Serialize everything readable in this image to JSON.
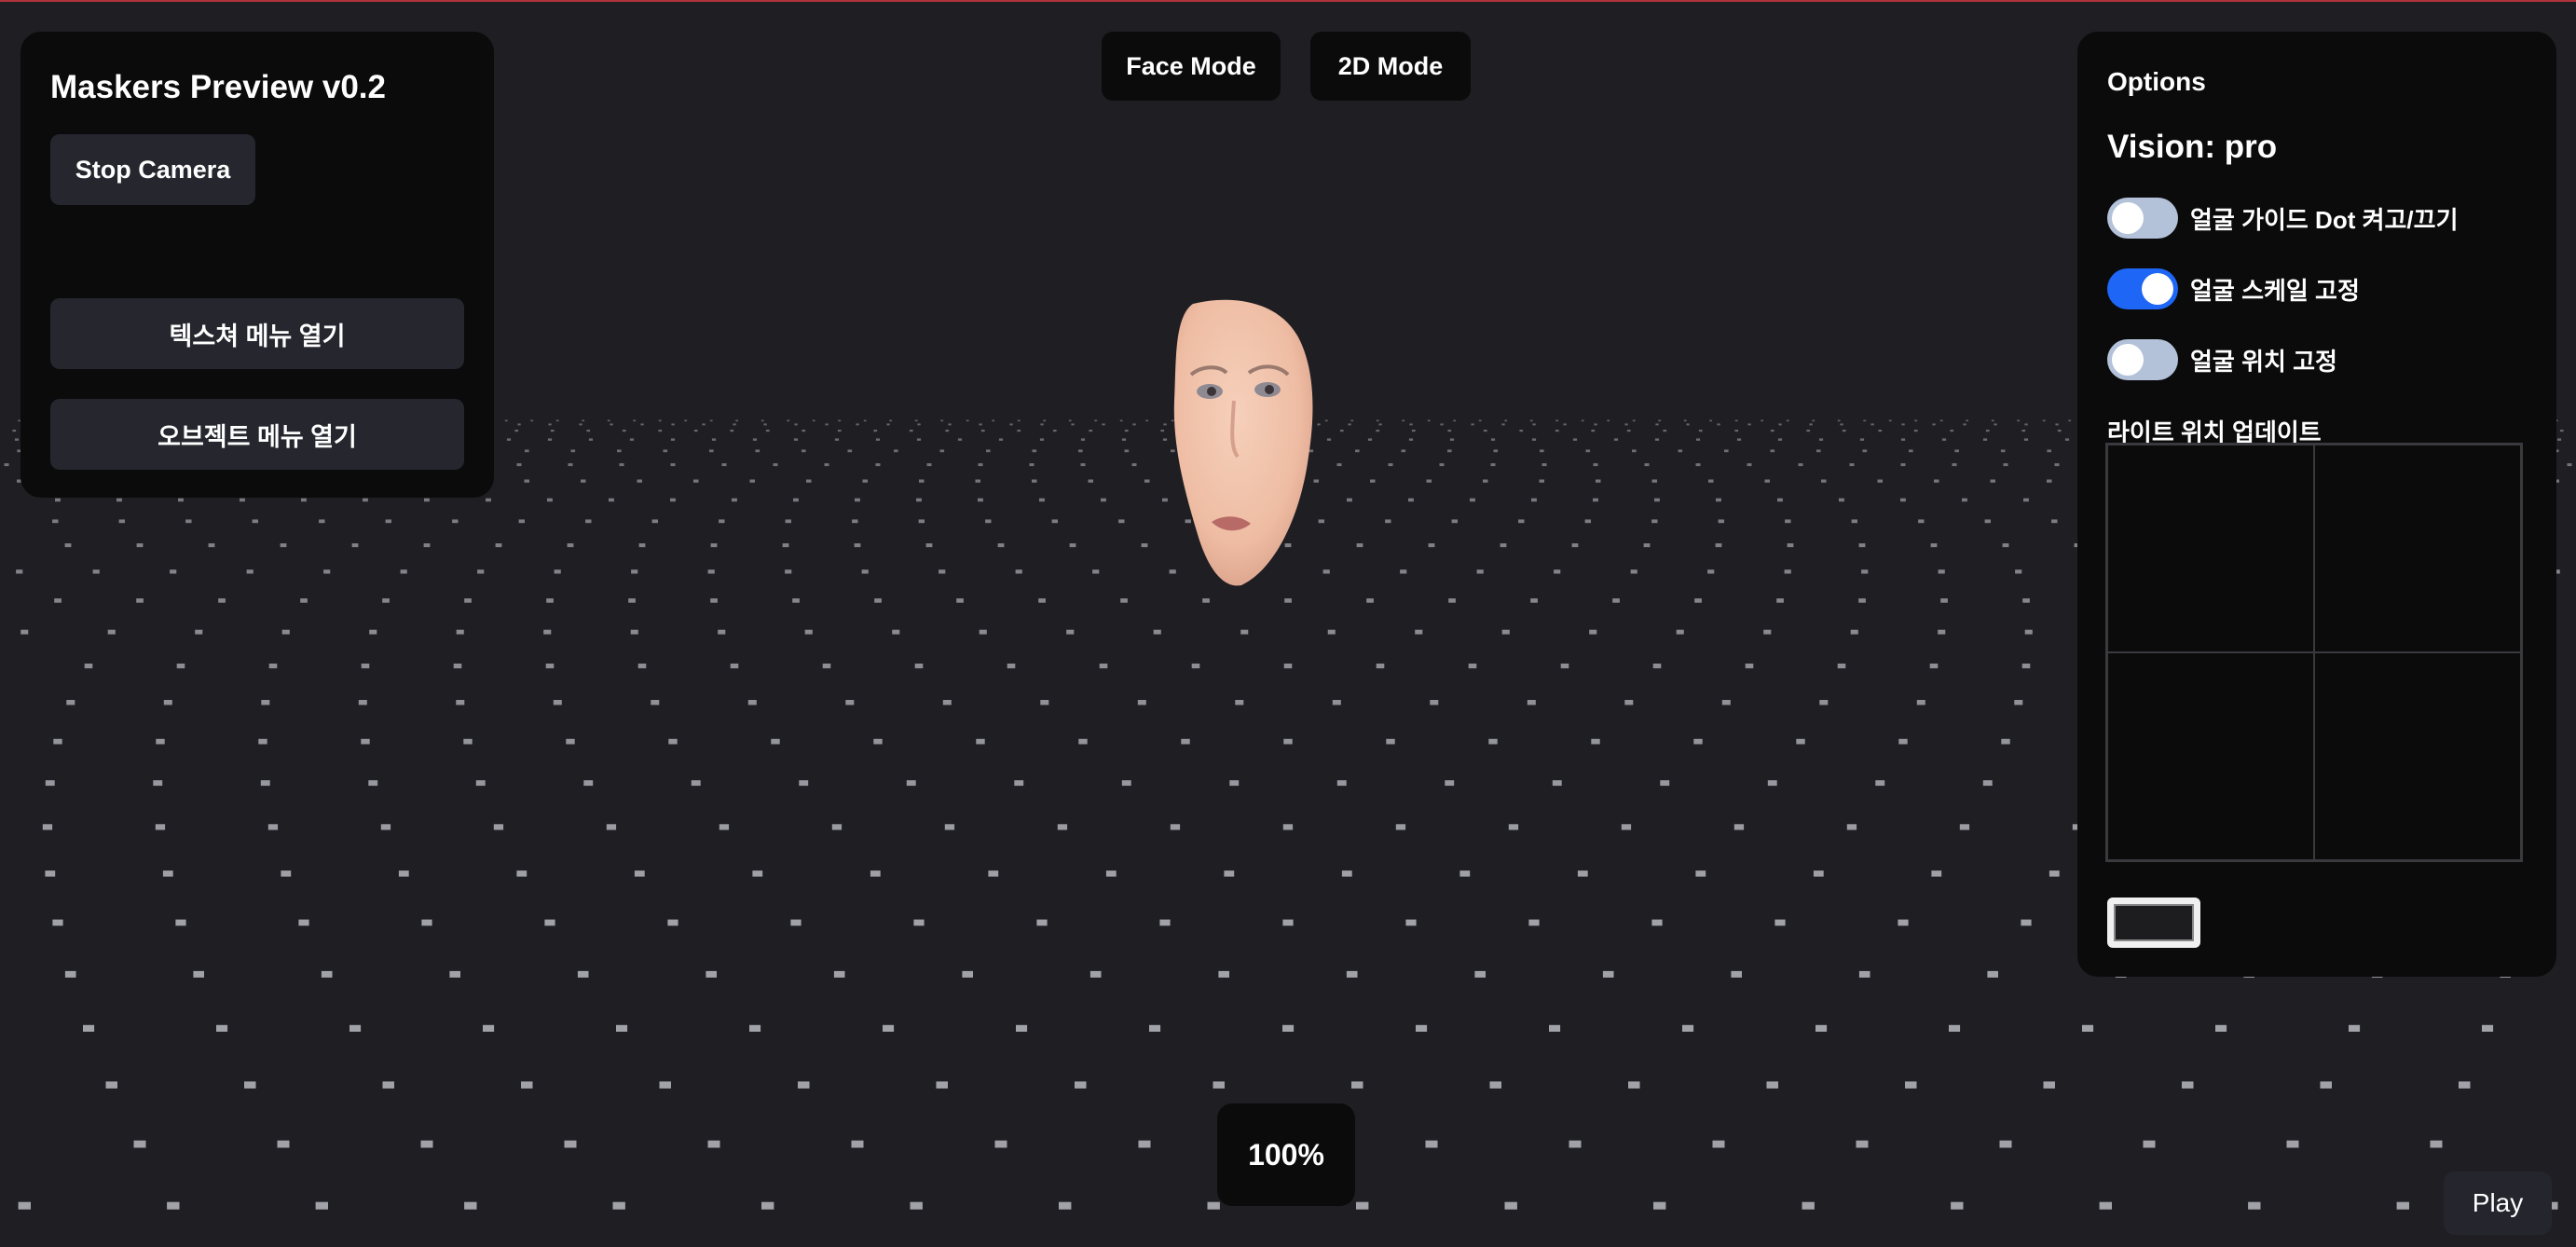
{
  "left_panel": {
    "title": "Maskers Preview v0.2",
    "stop_camera": "Stop Camera",
    "texture_menu": "텍스쳐 메뉴 열기",
    "object_menu": "오브젝트 메뉴 열기"
  },
  "modes": {
    "face_mode": "Face Mode",
    "mode_2d": "2D Mode"
  },
  "options": {
    "title": "Options",
    "vision": "Vision: pro",
    "toggles": [
      {
        "label": "얼굴 가이드 Dot 켜고/끄기",
        "on": false
      },
      {
        "label": "얼굴 스케일 고정",
        "on": true
      },
      {
        "label": "얼굴 위치 고정",
        "on": false
      }
    ],
    "light_label": "라이트 위치 업데이트"
  },
  "zoom": "100%",
  "play": "Play",
  "colors": {
    "background": "#1f1e23",
    "panel": "#0b0b0c",
    "button": "#26262f",
    "toggle_on": "#1e66f5",
    "toggle_off": "#b3c2d9",
    "accent_line": "#b0333a"
  }
}
